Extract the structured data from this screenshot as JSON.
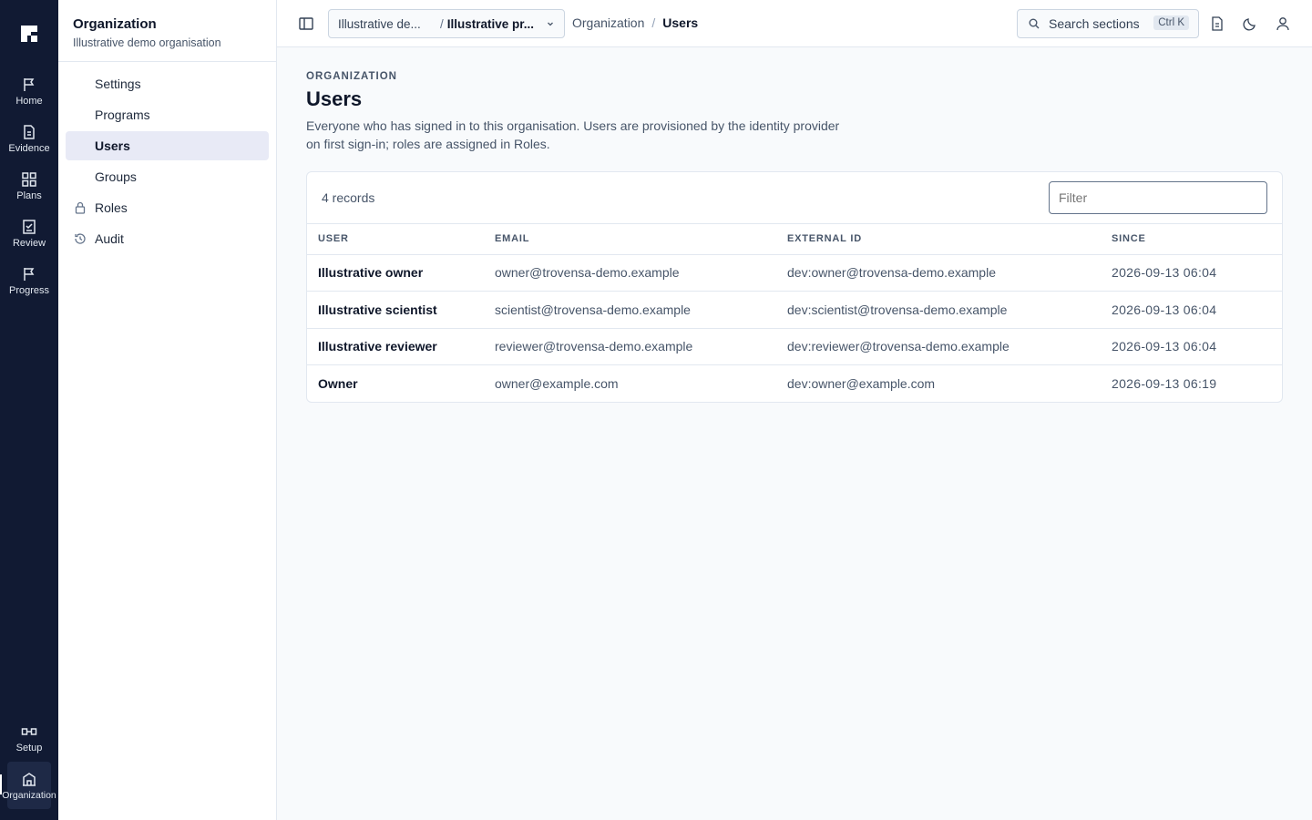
{
  "rail": {
    "items": [
      {
        "label": "Home",
        "icon": "flag-icon"
      },
      {
        "label": "Evidence",
        "icon": "document-icon"
      },
      {
        "label": "Plans",
        "icon": "grid-icon"
      },
      {
        "label": "Review",
        "icon": "checklist-icon"
      },
      {
        "label": "Progress",
        "icon": "flag-icon"
      }
    ],
    "bottom": [
      {
        "label": "Setup",
        "icon": "setup-icon"
      },
      {
        "label": "Organization",
        "icon": "building-icon"
      }
    ]
  },
  "sidebar": {
    "title": "Organization",
    "subtitle": "Illustrative demo organisation",
    "items": [
      {
        "label": "Settings"
      },
      {
        "label": "Programs"
      },
      {
        "label": "Users"
      },
      {
        "label": "Groups"
      },
      {
        "label": "Roles"
      },
      {
        "label": "Audit"
      }
    ]
  },
  "topbar": {
    "scope_org": "Illustrative de...",
    "scope_sep": "/",
    "scope_program": "Illustrative pr...",
    "breadcrumb": [
      "Organization",
      "Users"
    ],
    "breadcrumb_sep": "/",
    "search_label": "Search sections",
    "search_shortcut": "Ctrl K"
  },
  "page": {
    "eyebrow": "ORGANIZATION",
    "title": "Users",
    "description": "Everyone who has signed in to this organisation. Users are provisioned by the identity provider on first sign-in; roles are assigned in Roles."
  },
  "table": {
    "count": "4 records",
    "filter_placeholder": "Filter",
    "headers": [
      "USER",
      "EMAIL",
      "EXTERNAL ID",
      "SINCE"
    ],
    "rows": [
      [
        "Illustrative owner",
        "owner@trovensa-demo.example",
        "dev:owner@trovensa-demo.example",
        "2026-09-13 06:04"
      ],
      [
        "Illustrative scientist",
        "scientist@trovensa-demo.example",
        "dev:scientist@trovensa-demo.example",
        "2026-09-13 06:04"
      ],
      [
        "Illustrative reviewer",
        "reviewer@trovensa-demo.example",
        "dev:reviewer@trovensa-demo.example",
        "2026-09-13 06:04"
      ],
      [
        "Owner",
        "owner@example.com",
        "dev:owner@example.com",
        "2026-09-13 06:19"
      ]
    ]
  },
  "colors": {
    "rail_bg": "#111a33",
    "active_item_bg": "#e8eaf6",
    "page_bg": "#f8fafc"
  }
}
